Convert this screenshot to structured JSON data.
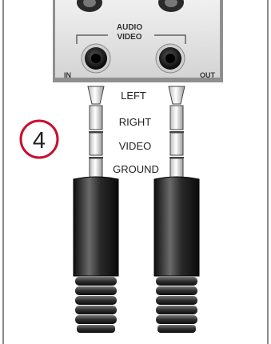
{
  "panel": {
    "header_top": "AUDIO",
    "header_bottom": "VIDEO",
    "in_label": "IN",
    "out_label": "OUT"
  },
  "step_badge": {
    "number": "4",
    "color": "#c8102e"
  },
  "plug_segments": [
    "LEFT",
    "RIGHT",
    "VIDEO",
    "GROUND"
  ],
  "colors": {
    "border": "#8a8a8a",
    "panel_face": "#e4e4e4",
    "plug_body": "#2b2b2b",
    "jack_ring": "#111111",
    "label_text": "#222222"
  },
  "icons": {
    "connector": "trrs-plug-icon",
    "jack": "rca-jack-icon"
  }
}
